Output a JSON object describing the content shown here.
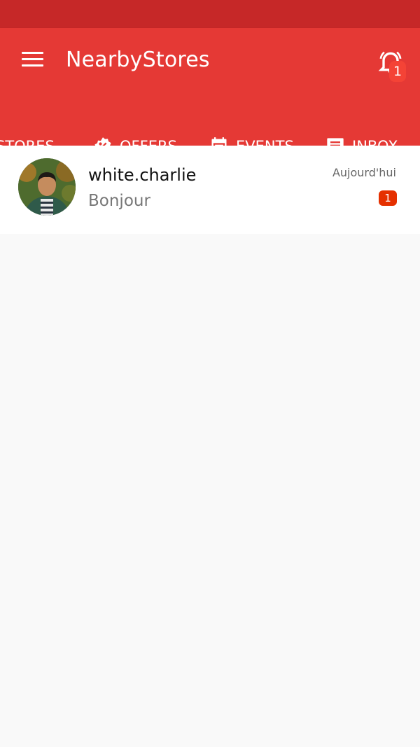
{
  "app": {
    "title": "NearbyStores"
  },
  "notifications": {
    "count": "1"
  },
  "tabs": [
    {
      "label": "STORES",
      "icon": "store-icon"
    },
    {
      "label": "OFFERS",
      "icon": "percent-badge-icon"
    },
    {
      "label": "EVENTS",
      "icon": "calendar-icon"
    },
    {
      "label": "INBOX",
      "icon": "message-icon"
    }
  ],
  "active_tab": "INBOX",
  "conversations": [
    {
      "name": "white.charlie",
      "last_message": "Bonjour",
      "time": "Aujourd'hui",
      "unread": "1"
    }
  ],
  "colors": {
    "status_bar": "#c62828",
    "app_bar": "#e53935",
    "badge": "#e53000",
    "background": "#f9f9f9"
  }
}
